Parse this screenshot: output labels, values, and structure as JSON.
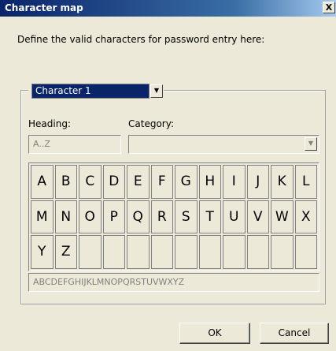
{
  "window": {
    "title": "Character map",
    "close_glyph": "X"
  },
  "instruction": "Define the valid characters for password entry here:",
  "character_select": {
    "value": "Character 1",
    "arrow": "▼"
  },
  "heading": {
    "label": "Heading:",
    "value": "A..Z"
  },
  "category": {
    "label": "Category:",
    "value": "",
    "arrow": "▼"
  },
  "characters": [
    "A",
    "B",
    "C",
    "D",
    "E",
    "F",
    "G",
    "H",
    "I",
    "J",
    "K",
    "L",
    "M",
    "N",
    "O",
    "P",
    "Q",
    "R",
    "S",
    "T",
    "U",
    "V",
    "W",
    "X",
    "Y",
    "Z",
    "",
    "",
    "",
    "",
    "",
    "",
    "",
    "",
    "",
    ""
  ],
  "preview": "ABCDEFGHIJKLMNOPQRSTUVWXYZ",
  "buttons": {
    "ok": "OK",
    "cancel": "Cancel"
  }
}
